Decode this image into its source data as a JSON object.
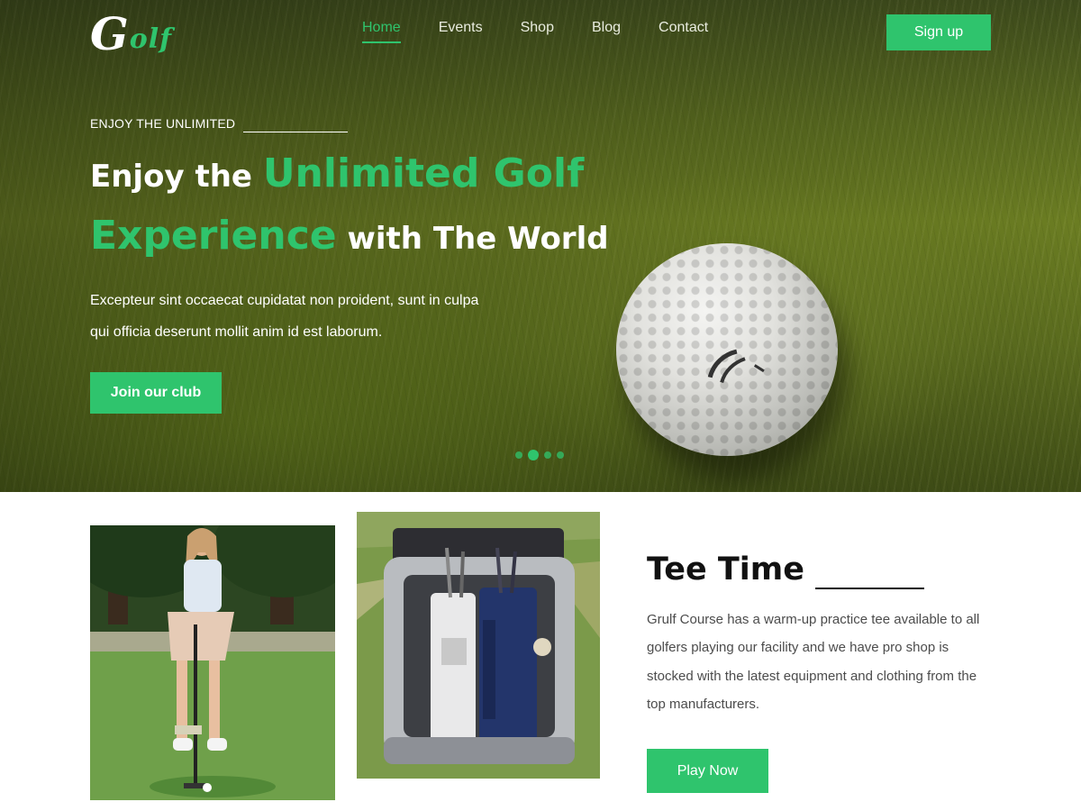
{
  "brand": {
    "logo_initial": "G",
    "logo_rest": "olf",
    "accent_color": "#2fc46d"
  },
  "nav": {
    "items": [
      {
        "label": "Home",
        "active": true
      },
      {
        "label": "Events",
        "active": false
      },
      {
        "label": "Shop",
        "active": false
      },
      {
        "label": "Blog",
        "active": false
      },
      {
        "label": "Contact",
        "active": false
      }
    ],
    "signup_label": "Sign up"
  },
  "hero": {
    "eyebrow": "ENJOY THE UNLIMITED",
    "headline": {
      "part1": "Enjoy the ",
      "part2": "Unlimited Golf",
      "part3": "Experience",
      "part4": " with The World"
    },
    "description_line1": "Excepteur sint occaecat cupidatat non proident, sunt in culpa",
    "description_line2": "qui officia deserunt mollit anim id est laborum.",
    "cta_label": "Join our club",
    "slider": {
      "count": 4,
      "active_index": 1
    }
  },
  "tee_time": {
    "title": "Tee Time",
    "description": "Grulf Course has a warm-up practice tee available to all golfers playing our facility and we have pro shop is stocked with the latest equipment and clothing from the top manufacturers.",
    "cta_label": "Play Now"
  }
}
